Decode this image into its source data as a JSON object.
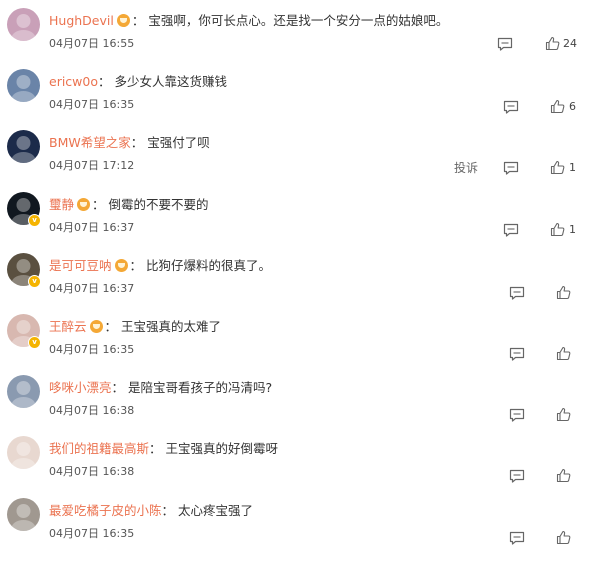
{
  "comments": [
    {
      "user": "HughDevil",
      "text": "宝强啊，你可长点心。还是找一个安分一点的姑娘吧。",
      "time": "04月07日 16:55",
      "likes": "24",
      "level_badge": true,
      "verified": false,
      "avatar_color": "#c9a0b8"
    },
    {
      "user": "ericw0o",
      "text": "多少女人靠这货赚钱",
      "time": "04月07日 16:35",
      "likes": "6",
      "level_badge": false,
      "verified": false,
      "avatar_color": "#6a84a8"
    },
    {
      "user": "BMW希望之家",
      "text": "宝强付了呗",
      "time": "04月07日 17:12",
      "likes": "1",
      "level_badge": false,
      "verified": false,
      "report_label": "投诉",
      "avatar_color": "#1c2b4a"
    },
    {
      "user": "璽静",
      "text": "倒霉的不要不要的",
      "time": "04月07日 16:37",
      "likes": "1",
      "level_badge": true,
      "verified": true,
      "avatar_color": "#111820"
    },
    {
      "user": "是可可豆呐",
      "text": "比狗仔爆料的很真了。",
      "time": "04月07日 16:37",
      "likes": "",
      "level_badge": true,
      "verified": true,
      "avatar_color": "#5a5040"
    },
    {
      "user": "王醉云",
      "text": "王宝强真的太难了",
      "time": "04月07日 16:35",
      "likes": "",
      "level_badge": true,
      "verified": true,
      "avatar_color": "#d8b8b0"
    },
    {
      "user": "哆咪小漂亮",
      "text": "是陪宝哥看孩子的冯清吗?",
      "time": "04月07日 16:38",
      "likes": "",
      "level_badge": false,
      "verified": false,
      "avatar_color": "#8a9ab0"
    },
    {
      "user": "我们的祖籍最高斯",
      "text": "王宝强真的好倒霉呀",
      "time": "04月07日 16:38",
      "likes": "",
      "level_badge": false,
      "verified": false,
      "avatar_color": "#e8d8d0"
    },
    {
      "user": "最爱吃橘子皮的小陈",
      "text": "太心疼宝强了",
      "time": "04月07日 16:35",
      "likes": "",
      "level_badge": false,
      "verified": false,
      "avatar_color": "#a09890"
    }
  ],
  "separator": "："
}
